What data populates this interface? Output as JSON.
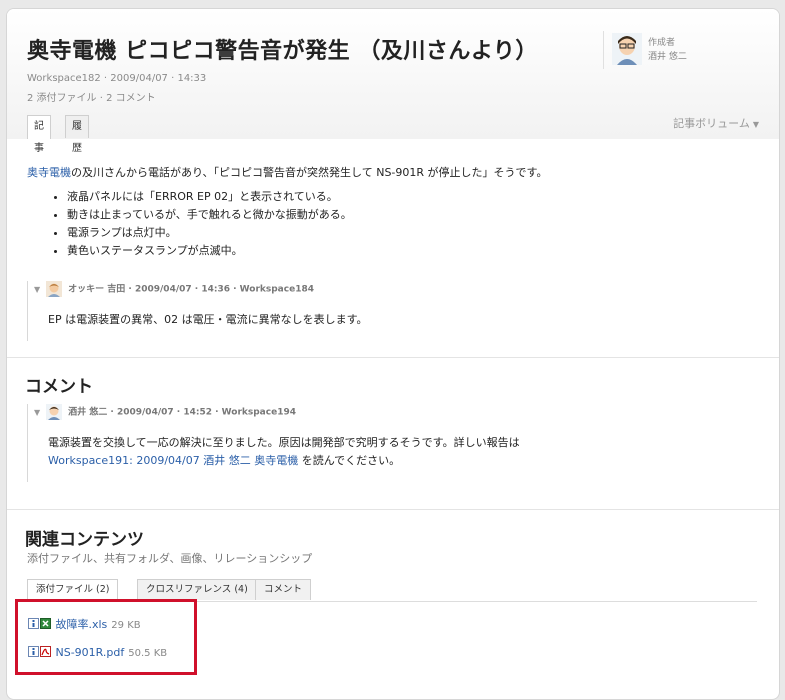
{
  "article": {
    "title": "奥寺電機 ピコピコ警告音が発生 （及川さんより）",
    "meta_line1": "Workspace182 · 2009/04/07 · 14:33",
    "meta_line2": "2 添付ファイル · 2 コメント",
    "author_label": "作成者",
    "author_name": "酒井 悠二",
    "tabs": [
      "記事",
      "履歴"
    ],
    "volume_label": "記事ボリューム",
    "body_link": "奥寺電機",
    "body_text": "の及川さんから電話があり、「ピコピコ警告音が突然発生して NS-901R が停止した」そうです。",
    "bullets": [
      "液晶パネルには「ERROR EP 02」と表示されている。",
      "動きは止まっているが、手で触れると微かな振動がある。",
      "電源ランプは点灯中。",
      "黄色いステータスランプが点滅中。"
    ]
  },
  "reply1": {
    "header": "オッキー 吉田 · 2009/04/07 · 14:36 · Workspace184",
    "body": "EP は電源装置の異常、02 は電圧・電流に異常なしを表します。"
  },
  "comments": {
    "title": "コメント",
    "header": "酒井 悠二 · 2009/04/07 · 14:52 · Workspace194",
    "body_line1": "電源装置を交換して一応の解決に至りました。原因は開発部で究明するそうです。詳しい報告は",
    "body_link": "Workspace191: 2009/04/07 酒井 悠二 奥寺電機",
    "body_tail": " を読んでください。"
  },
  "related": {
    "title": "関連コンテンツ",
    "subtitle": "添付ファイル、共有フォルダ、画像、リレーションシップ",
    "tabs": [
      "添付ファイル (2)",
      "クロスリファレンス (4)",
      "コメント"
    ],
    "files": [
      {
        "name": "故障率.xls",
        "size": "29 KB",
        "icon": "excel-file-icon"
      },
      {
        "name": "NS-901R.pdf",
        "size": "50.5 KB",
        "icon": "pdf-file-icon"
      }
    ]
  },
  "colors": {
    "link": "#2b5fa8",
    "highlight": "#d0102b"
  }
}
